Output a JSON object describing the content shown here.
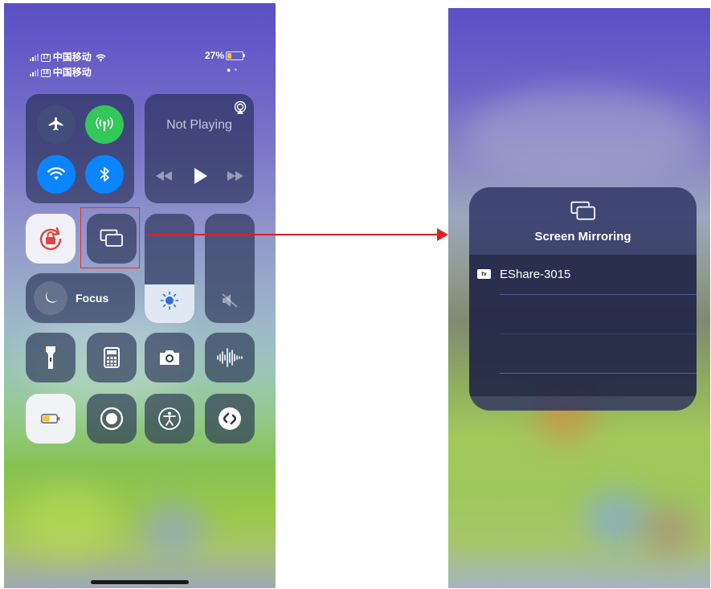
{
  "control_center": {
    "status_bar": {
      "sim1_slot": "17",
      "sim2_slot": "18",
      "carrier1": "中国移动",
      "carrier2": "中国移动",
      "battery_percent": "27%",
      "battery_level": 0.27
    },
    "media": {
      "status": "Not Playing"
    },
    "focus": {
      "label": "Focus"
    },
    "brightness_level": 0.35
  },
  "screen_mirroring": {
    "title": "Screen Mirroring",
    "devices": [
      {
        "badge": "tv",
        "name": "EShare-3015"
      }
    ]
  },
  "colors": {
    "annotation": "#e02020",
    "cellular_green": "#34c759",
    "wifi_blue": "#0a84ff",
    "rotation_lock_red": "#e0453b"
  }
}
